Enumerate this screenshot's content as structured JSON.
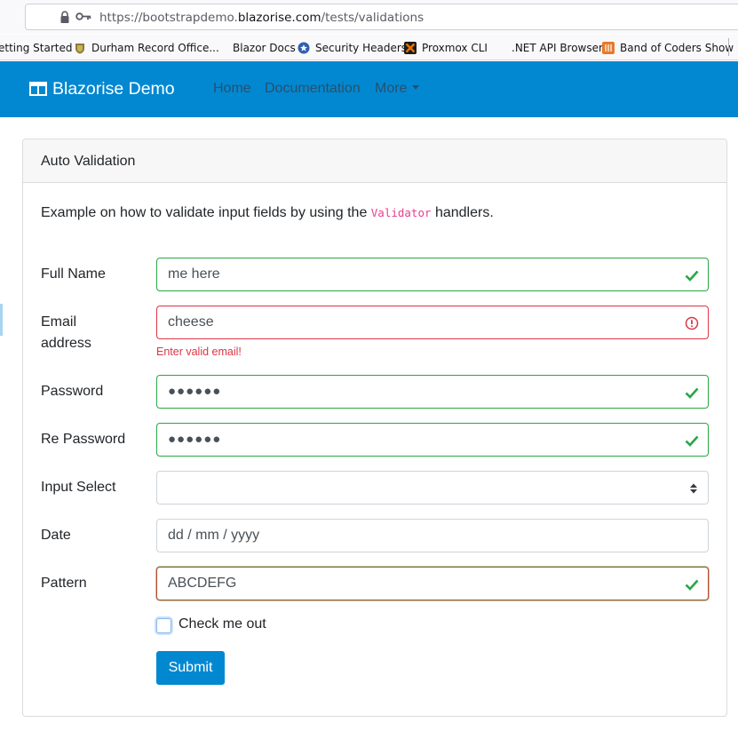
{
  "browser": {
    "url_prefix": "https://bootstrapdemo.",
    "url_domain": "blazorise.com",
    "url_path": "/tests/validations",
    "bookmarks": [
      "etting Started",
      "Durham Record Office...",
      "Blazor Docs",
      "Security Headers",
      "Proxmox CLI",
      ".NET API Browser",
      "Band of Coders Show"
    ]
  },
  "navbar": {
    "brand": "Blazorise Demo",
    "links": [
      "Home",
      "Documentation",
      "More"
    ],
    "color": "#0288d1"
  },
  "card": {
    "title": "Auto Validation",
    "description_before": "Example on how to validate input fields by using the ",
    "description_code": "Validator",
    "description_after": " handlers."
  },
  "form": {
    "full_name": {
      "label": "Full Name",
      "value": "me here",
      "state": "valid"
    },
    "email": {
      "label_line1": "Email",
      "label_line2": "address",
      "value": "cheese",
      "state": "invalid",
      "error": "Enter valid email!"
    },
    "password": {
      "label": "Password",
      "value": "●●●●●●",
      "state": "valid"
    },
    "re_password": {
      "label": "Re Password",
      "value": "●●●●●●",
      "state": "valid"
    },
    "input_select": {
      "label": "Input Select",
      "value": ""
    },
    "date": {
      "label": "Date",
      "placeholder": "dd / mm / yyyy"
    },
    "pattern": {
      "label": "Pattern",
      "value": "ABCDEFG",
      "state": "valid"
    },
    "checkbox": {
      "label": "Check me out",
      "checked": false
    },
    "submit_label": "Submit"
  },
  "colors": {
    "valid": "#28a745",
    "invalid": "#dc3545",
    "primary": "#0288d1",
    "code": "#e83e8c"
  }
}
